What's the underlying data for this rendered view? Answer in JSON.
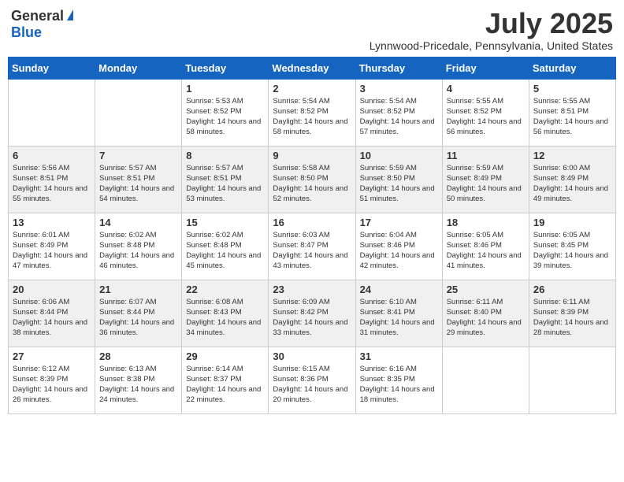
{
  "logo": {
    "general": "General",
    "blue": "Blue"
  },
  "title": "July 2025",
  "location": "Lynnwood-Pricedale, Pennsylvania, United States",
  "weekdays": [
    "Sunday",
    "Monday",
    "Tuesday",
    "Wednesday",
    "Thursday",
    "Friday",
    "Saturday"
  ],
  "weeks": [
    [
      {
        "day": "",
        "info": ""
      },
      {
        "day": "",
        "info": ""
      },
      {
        "day": "1",
        "info": "Sunrise: 5:53 AM\nSunset: 8:52 PM\nDaylight: 14 hours and 58 minutes."
      },
      {
        "day": "2",
        "info": "Sunrise: 5:54 AM\nSunset: 8:52 PM\nDaylight: 14 hours and 58 minutes."
      },
      {
        "day": "3",
        "info": "Sunrise: 5:54 AM\nSunset: 8:52 PM\nDaylight: 14 hours and 57 minutes."
      },
      {
        "day": "4",
        "info": "Sunrise: 5:55 AM\nSunset: 8:52 PM\nDaylight: 14 hours and 56 minutes."
      },
      {
        "day": "5",
        "info": "Sunrise: 5:55 AM\nSunset: 8:51 PM\nDaylight: 14 hours and 56 minutes."
      }
    ],
    [
      {
        "day": "6",
        "info": "Sunrise: 5:56 AM\nSunset: 8:51 PM\nDaylight: 14 hours and 55 minutes."
      },
      {
        "day": "7",
        "info": "Sunrise: 5:57 AM\nSunset: 8:51 PM\nDaylight: 14 hours and 54 minutes."
      },
      {
        "day": "8",
        "info": "Sunrise: 5:57 AM\nSunset: 8:51 PM\nDaylight: 14 hours and 53 minutes."
      },
      {
        "day": "9",
        "info": "Sunrise: 5:58 AM\nSunset: 8:50 PM\nDaylight: 14 hours and 52 minutes."
      },
      {
        "day": "10",
        "info": "Sunrise: 5:59 AM\nSunset: 8:50 PM\nDaylight: 14 hours and 51 minutes."
      },
      {
        "day": "11",
        "info": "Sunrise: 5:59 AM\nSunset: 8:49 PM\nDaylight: 14 hours and 50 minutes."
      },
      {
        "day": "12",
        "info": "Sunrise: 6:00 AM\nSunset: 8:49 PM\nDaylight: 14 hours and 49 minutes."
      }
    ],
    [
      {
        "day": "13",
        "info": "Sunrise: 6:01 AM\nSunset: 8:49 PM\nDaylight: 14 hours and 47 minutes."
      },
      {
        "day": "14",
        "info": "Sunrise: 6:02 AM\nSunset: 8:48 PM\nDaylight: 14 hours and 46 minutes."
      },
      {
        "day": "15",
        "info": "Sunrise: 6:02 AM\nSunset: 8:48 PM\nDaylight: 14 hours and 45 minutes."
      },
      {
        "day": "16",
        "info": "Sunrise: 6:03 AM\nSunset: 8:47 PM\nDaylight: 14 hours and 43 minutes."
      },
      {
        "day": "17",
        "info": "Sunrise: 6:04 AM\nSunset: 8:46 PM\nDaylight: 14 hours and 42 minutes."
      },
      {
        "day": "18",
        "info": "Sunrise: 6:05 AM\nSunset: 8:46 PM\nDaylight: 14 hours and 41 minutes."
      },
      {
        "day": "19",
        "info": "Sunrise: 6:05 AM\nSunset: 8:45 PM\nDaylight: 14 hours and 39 minutes."
      }
    ],
    [
      {
        "day": "20",
        "info": "Sunrise: 6:06 AM\nSunset: 8:44 PM\nDaylight: 14 hours and 38 minutes."
      },
      {
        "day": "21",
        "info": "Sunrise: 6:07 AM\nSunset: 8:44 PM\nDaylight: 14 hours and 36 minutes."
      },
      {
        "day": "22",
        "info": "Sunrise: 6:08 AM\nSunset: 8:43 PM\nDaylight: 14 hours and 34 minutes."
      },
      {
        "day": "23",
        "info": "Sunrise: 6:09 AM\nSunset: 8:42 PM\nDaylight: 14 hours and 33 minutes."
      },
      {
        "day": "24",
        "info": "Sunrise: 6:10 AM\nSunset: 8:41 PM\nDaylight: 14 hours and 31 minutes."
      },
      {
        "day": "25",
        "info": "Sunrise: 6:11 AM\nSunset: 8:40 PM\nDaylight: 14 hours and 29 minutes."
      },
      {
        "day": "26",
        "info": "Sunrise: 6:11 AM\nSunset: 8:39 PM\nDaylight: 14 hours and 28 minutes."
      }
    ],
    [
      {
        "day": "27",
        "info": "Sunrise: 6:12 AM\nSunset: 8:39 PM\nDaylight: 14 hours and 26 minutes."
      },
      {
        "day": "28",
        "info": "Sunrise: 6:13 AM\nSunset: 8:38 PM\nDaylight: 14 hours and 24 minutes."
      },
      {
        "day": "29",
        "info": "Sunrise: 6:14 AM\nSunset: 8:37 PM\nDaylight: 14 hours and 22 minutes."
      },
      {
        "day": "30",
        "info": "Sunrise: 6:15 AM\nSunset: 8:36 PM\nDaylight: 14 hours and 20 minutes."
      },
      {
        "day": "31",
        "info": "Sunrise: 6:16 AM\nSunset: 8:35 PM\nDaylight: 14 hours and 18 minutes."
      },
      {
        "day": "",
        "info": ""
      },
      {
        "day": "",
        "info": ""
      }
    ]
  ]
}
